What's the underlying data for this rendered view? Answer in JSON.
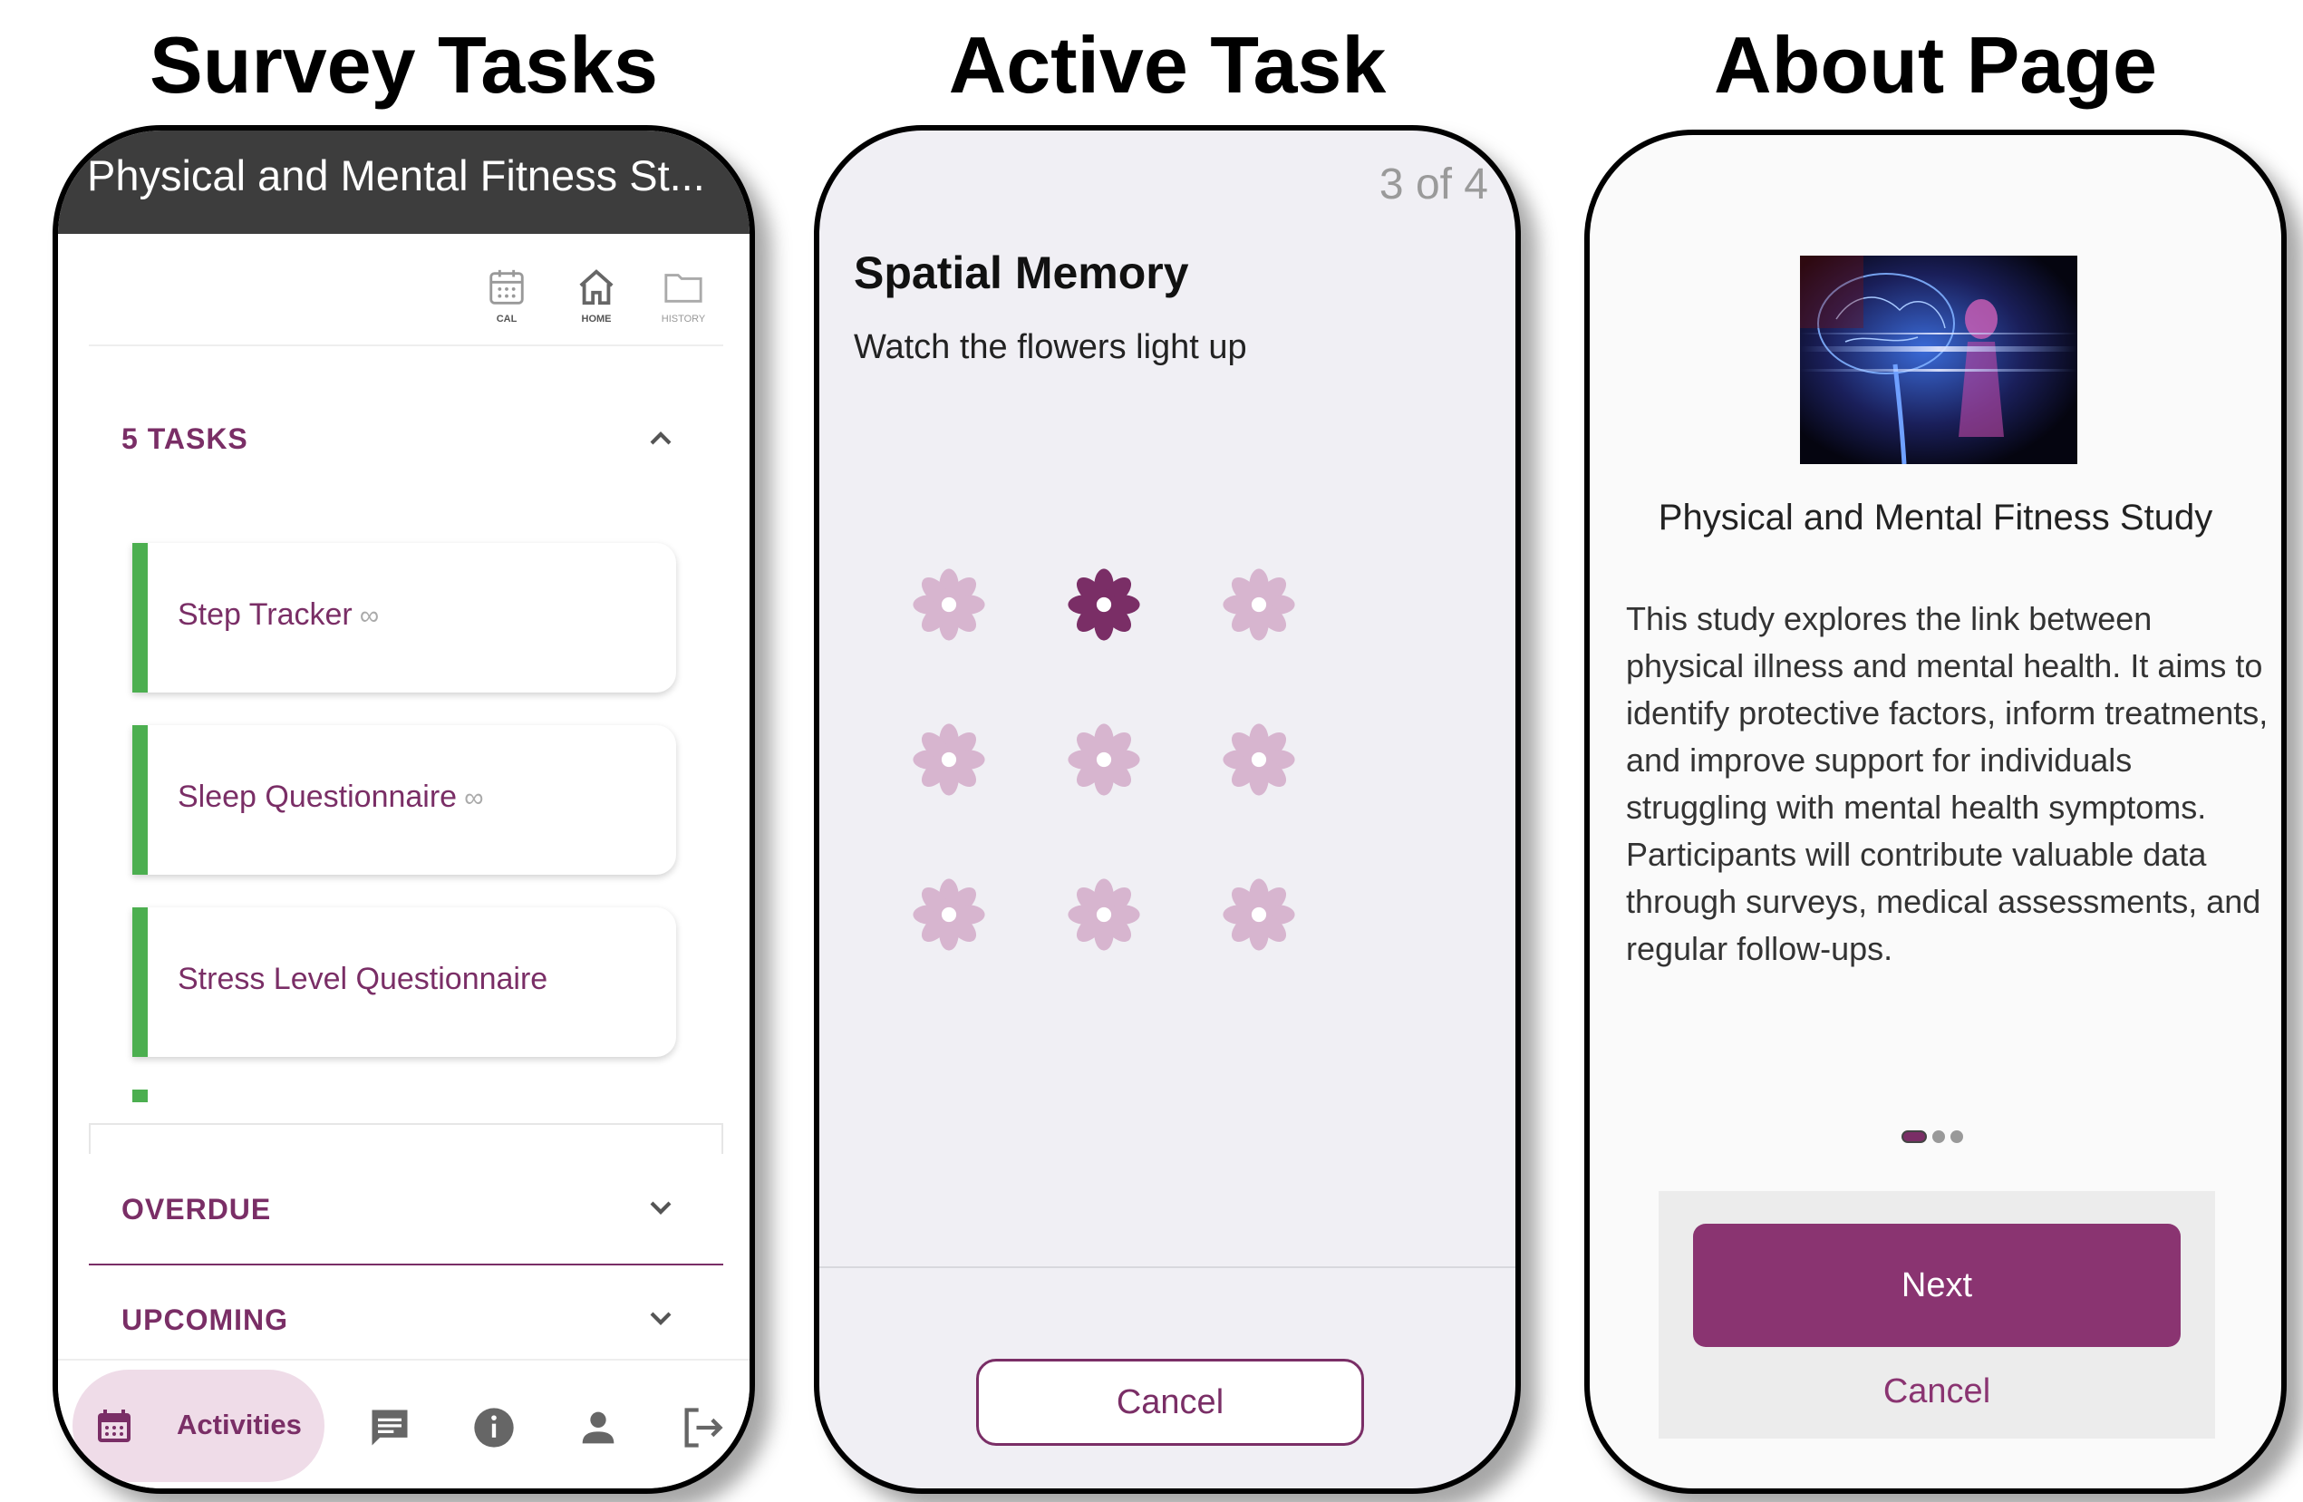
{
  "panels": {
    "survey_title": "Survey Tasks",
    "active_title": "Active Task",
    "about_title": "About Page"
  },
  "survey": {
    "header_title": "Physical and Mental Fitness St...",
    "topnav": [
      {
        "label": "CAL",
        "icon": "calendar-icon"
      },
      {
        "label": "HOME",
        "icon": "home-icon"
      },
      {
        "label": "HISTORY",
        "icon": "folder-icon"
      }
    ],
    "tasks_heading": "5 TASKS",
    "tasks": [
      {
        "label": "Step Tracker",
        "repeat": "∞"
      },
      {
        "label": "Sleep Questionnaire",
        "repeat": "∞"
      },
      {
        "label": "Stress Level Questionnaire",
        "repeat": ""
      }
    ],
    "overdue_heading": "OVERDUE",
    "upcoming_heading": "UPCOMING",
    "bottomnav": {
      "activities_label": "Activities",
      "icons": [
        "calendar-icon",
        "message-icon",
        "info-icon",
        "person-icon",
        "logout-icon"
      ]
    },
    "colors": {
      "accent": "#7a2e66",
      "task_bar": "#4caf50",
      "header": "#3d3d3d"
    }
  },
  "active": {
    "progress": "3 of 4",
    "title": "Spatial Memory",
    "instruction": "Watch the flowers light up",
    "grid": {
      "rows": 3,
      "cols": 3,
      "lit_index": 1
    },
    "cancel_label": "Cancel",
    "colors": {
      "lit": "#7a2e66",
      "unlit": "#d7b5cf"
    }
  },
  "about": {
    "study_title": "Physical and Mental Fitness Study",
    "description": "This study explores the link between physical illness and mental health. It aims to identify protective factors, inform treatments, and improve support for individuals struggling with mental health symptoms. Participants will contribute valuable data through surveys, medical assessments, and regular follow-ups.",
    "page_dots": {
      "count": 3,
      "active": 0
    },
    "next_label": "Next",
    "cancel_label": "Cancel"
  }
}
